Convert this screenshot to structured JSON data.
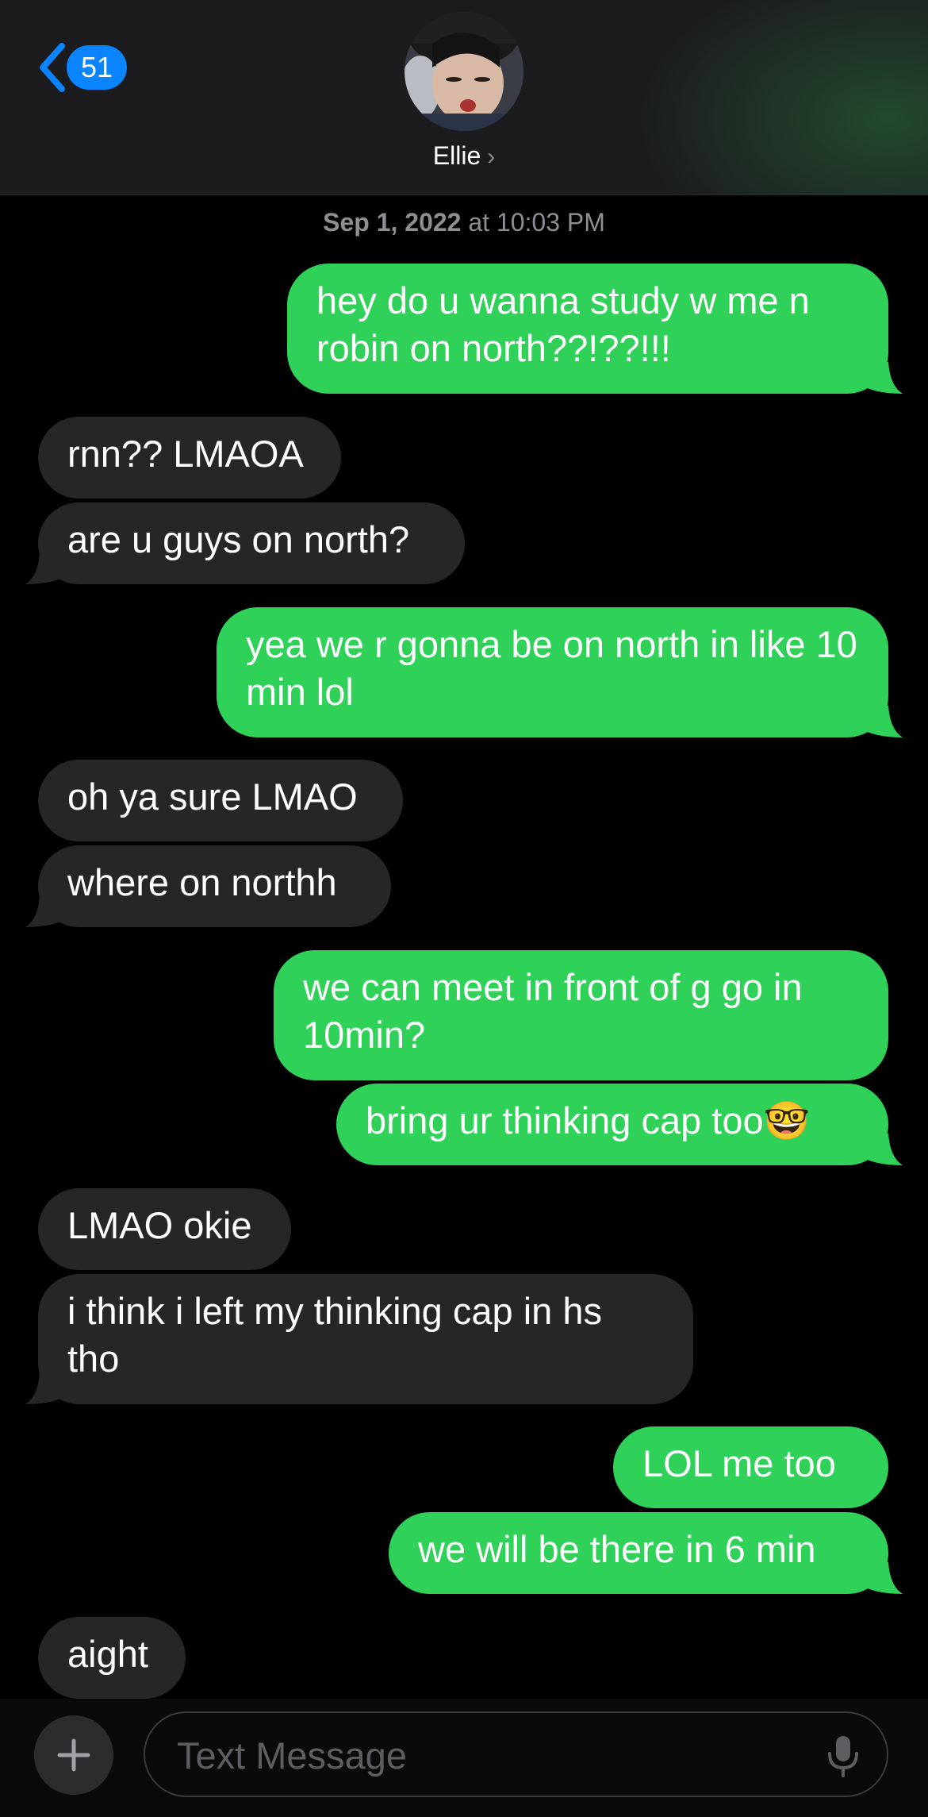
{
  "header": {
    "back_count": "51",
    "contact_name": "Ellie",
    "contact_chevron": "›"
  },
  "thread": {
    "timestamp_date": "Sep 1, 2022",
    "timestamp_time": " at 10:03 PM",
    "messages": [
      {
        "from": "me",
        "text": "hey do u wanna study w me n robin on north??!??!!!"
      },
      {
        "from": "them",
        "text": "rnn?? LMAOA"
      },
      {
        "from": "them",
        "text": "are u guys on north?"
      },
      {
        "from": "me",
        "text": "yea we r gonna be on north in like 10 min lol"
      },
      {
        "from": "them",
        "text": "oh ya sure LMAO"
      },
      {
        "from": "them",
        "text": "where on northh"
      },
      {
        "from": "me",
        "text": "we can meet in front of g go in 10min?"
      },
      {
        "from": "me",
        "text": "bring ur thinking cap too🤓"
      },
      {
        "from": "them",
        "text": "LMAO okie"
      },
      {
        "from": "them",
        "text": "i think i left my thinking cap in hs tho"
      },
      {
        "from": "me",
        "text": "LOL me too"
      },
      {
        "from": "me",
        "text": "we will be there in 6 min"
      },
      {
        "from": "them",
        "text": "aight"
      }
    ]
  },
  "composer": {
    "placeholder": "Text Message",
    "plus_icon": "plus-icon",
    "mic_icon": "microphone-icon"
  },
  "colors": {
    "sent_bubble": "#30d158",
    "received_bubble": "#262628",
    "accent": "#0a84ff"
  }
}
